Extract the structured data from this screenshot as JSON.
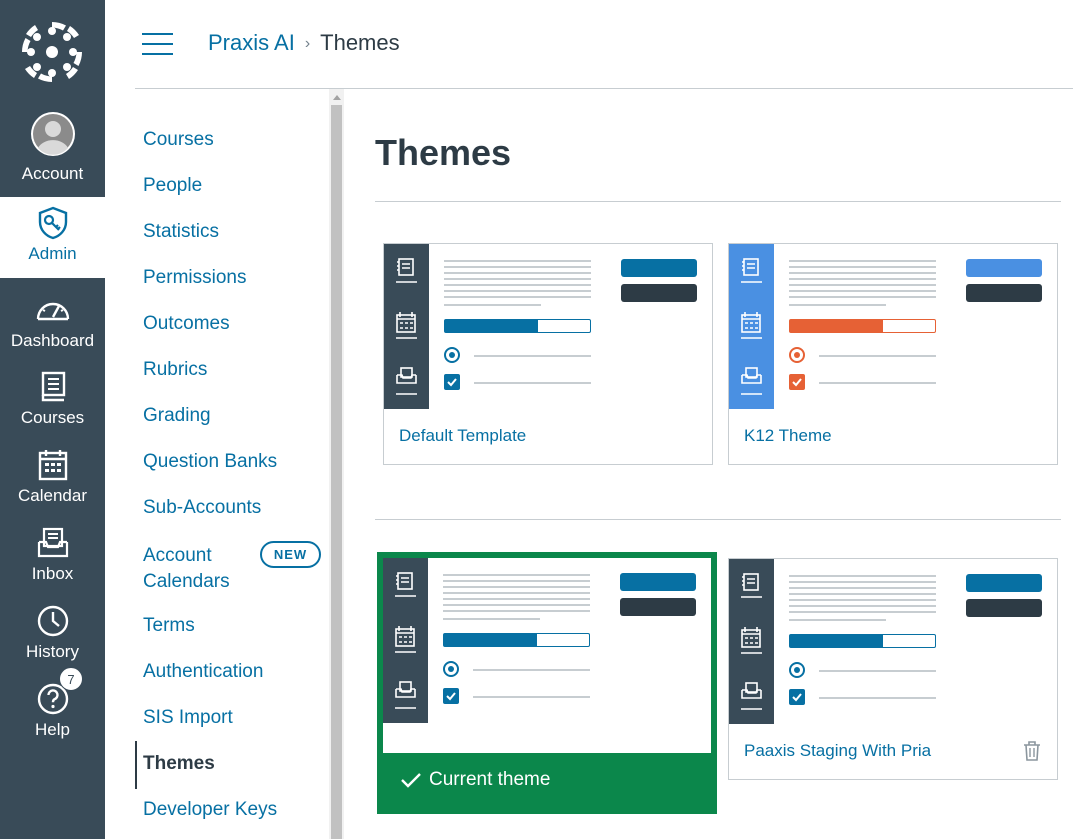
{
  "global_nav": {
    "items": [
      {
        "label": "Account",
        "icon": "avatar-icon"
      },
      {
        "label": "Admin",
        "icon": "admin-shield-icon",
        "active": true
      },
      {
        "label": "Dashboard",
        "icon": "dashboard-gauge-icon"
      },
      {
        "label": "Courses",
        "icon": "courses-book-icon"
      },
      {
        "label": "Calendar",
        "icon": "calendar-icon"
      },
      {
        "label": "Inbox",
        "icon": "inbox-icon"
      },
      {
        "label": "History",
        "icon": "history-clock-icon"
      },
      {
        "label": "Help",
        "icon": "help-icon"
      }
    ],
    "help_badge": "7"
  },
  "breadcrumb": {
    "parent": "Praxis AI",
    "current": "Themes"
  },
  "section_nav": {
    "items": [
      "Courses",
      "People",
      "Statistics",
      "Permissions",
      "Outcomes",
      "Rubrics",
      "Grading",
      "Question Banks",
      "Sub-Accounts",
      "Account Calendars",
      "Terms",
      "Authentication",
      "SIS Import",
      "Themes",
      "Developer Keys"
    ],
    "account_calendars_line1": "Account",
    "account_calendars_line2": "Calendars",
    "new_badge": "NEW",
    "active": "Themes"
  },
  "main": {
    "title": "Themes",
    "themes": [
      {
        "name": "Default Template",
        "side_color": "#394b58",
        "accent": "#0770a3",
        "primary_button": "#0770a3",
        "progress": 0.64
      },
      {
        "name": "K12 Theme",
        "side_color": "#4a90e2",
        "accent": "#e66135",
        "primary_button": "#4a90e2",
        "progress": 0.64
      },
      {
        "name": "Current theme",
        "side_color": "#394b58",
        "accent": "#0770a3",
        "primary_button": "#0770a3",
        "progress": 0.64,
        "is_current": true
      },
      {
        "name": "Paaxis Staging With Pria",
        "side_color": "#394b58",
        "accent": "#0770a3",
        "primary_button": "#0770a3",
        "progress": 0.64,
        "deletable": true
      }
    ],
    "current_label": "Current theme"
  },
  "colors": {
    "nav_bg": "#394b58",
    "link": "#0770a3",
    "current_green": "#0b874b"
  }
}
